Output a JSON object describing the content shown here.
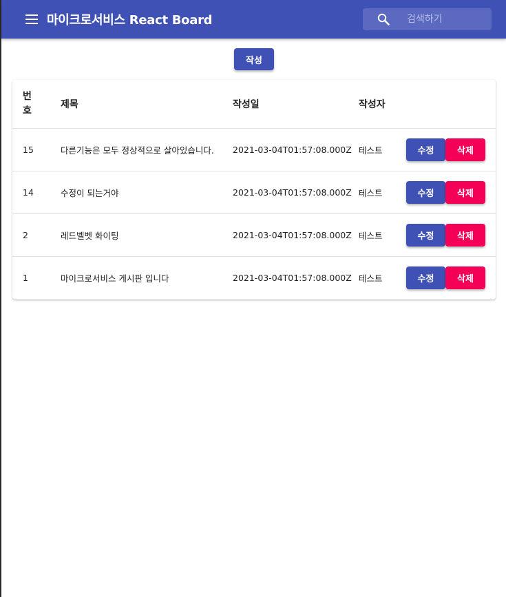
{
  "appbar": {
    "title": "마이크로서비스 React Board",
    "search_placeholder": "검색하기"
  },
  "toolbar": {
    "write_label": "작성"
  },
  "table": {
    "headers": {
      "num": "번호",
      "title": "제목",
      "date": "작성일",
      "author": "작성자"
    },
    "rows": [
      {
        "num": "15",
        "title": "다른기능은 모두 정상적으로 살아있습니다.",
        "date": "2021-03-04T01:57:08.000Z",
        "author": "테스트",
        "edit_label": "수정",
        "delete_label": "삭제"
      },
      {
        "num": "14",
        "title": "수정이 되는거야",
        "date": "2021-03-04T01:57:08.000Z",
        "author": "테스트",
        "edit_label": "수정",
        "delete_label": "삭제"
      },
      {
        "num": "2",
        "title": "레드벨벳 화이팅",
        "date": "2021-03-04T01:57:08.000Z",
        "author": "테스트",
        "edit_label": "수정",
        "delete_label": "삭제"
      },
      {
        "num": "1",
        "title": "마이크로서비스 게시판 입니다",
        "date": "2021-03-04T01:57:08.000Z",
        "author": "테스트",
        "edit_label": "수정",
        "delete_label": "삭제"
      }
    ]
  },
  "colors": {
    "primary": "#3f51b5",
    "secondary": "#f50057"
  },
  "icons": {
    "menu": "menu-icon",
    "search": "search-icon"
  }
}
